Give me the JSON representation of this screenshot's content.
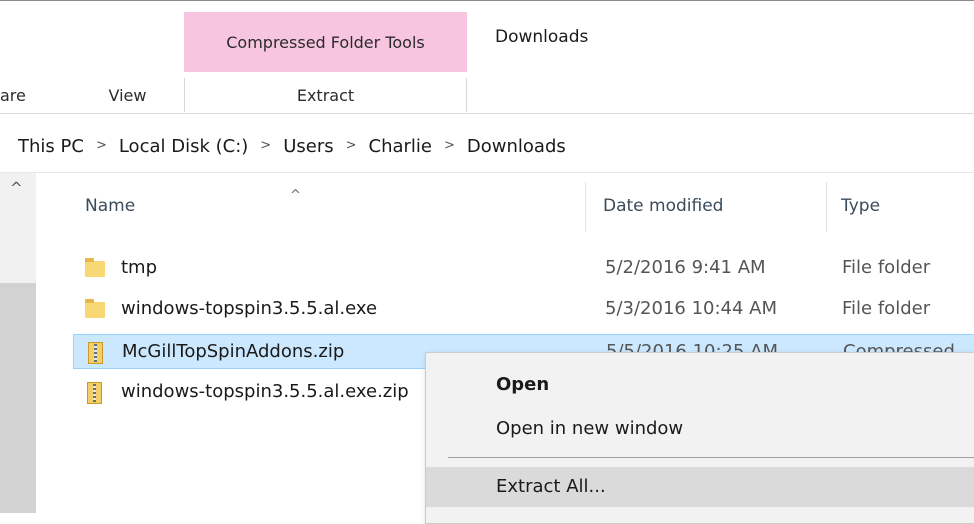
{
  "ribbon": {
    "context_header": "Compressed Folder Tools",
    "window_title": "Downloads",
    "tabs": {
      "share": "are",
      "view": "View",
      "extract": "Extract"
    }
  },
  "breadcrumb": [
    "This PC",
    "Local Disk (C:)",
    "Users",
    "Charlie",
    "Downloads"
  ],
  "columns": {
    "name": "Name",
    "date": "Date modified",
    "type": "Type"
  },
  "files": [
    {
      "name": "tmp",
      "date": "5/2/2016 9:41 AM",
      "type": "File folder",
      "icon": "folder-icon"
    },
    {
      "name": "windows-topspin3.5.5.al.exe",
      "date": "5/3/2016 10:44 AM",
      "type": "File folder",
      "icon": "folder-icon"
    },
    {
      "name": "McGillTopSpinAddons.zip",
      "date": "5/5/2016 10:25 AM",
      "type": "Compressed",
      "icon": "zip-icon",
      "selected": true
    },
    {
      "name": "windows-topspin3.5.5.al.exe.zip",
      "date": "",
      "type": "",
      "icon": "zip-icon"
    }
  ],
  "context_menu": {
    "open": "Open",
    "open_new_window": "Open in new window",
    "extract_all": "Extract All..."
  }
}
